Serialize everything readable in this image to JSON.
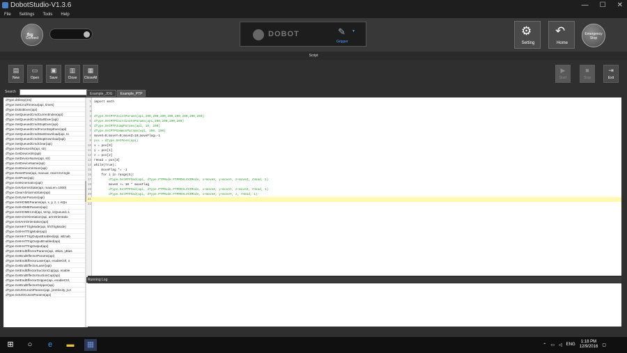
{
  "window": {
    "title": "DobotStudio-V1.3.6",
    "controls": [
      "—",
      "☐",
      "✕"
    ]
  },
  "menu": [
    "File",
    "Settings",
    "Tools",
    "Help"
  ],
  "topbar": {
    "connect_label": "Connect",
    "brand": "DOBOT",
    "end_tool": "Gripper",
    "setting_label": "Setting",
    "home_label": "Home",
    "estop_line1": "Emergency",
    "estop_line2": "Stop"
  },
  "section_title": "Script",
  "toolbar": {
    "new": "New",
    "open": "Open",
    "save": "Save",
    "close": "Close",
    "closeall": "CloseAll",
    "start": "Start",
    "stop": "Stop",
    "exit": "Exit"
  },
  "search": {
    "label": "Search",
    "value": ""
  },
  "api_list": [
    "dType.dSleep(ms)",
    "dType.SetCmdTimeout(api, times)",
    "dType.DobotExec(api)",
    "dType.SetQueuedCmdCurrentIndex(api)",
    "dType.SetQueuedCmdStartExec(api)",
    "dType.SetQueuedCmdStopExec(api)",
    "dType.SetQueuedCmdForceStopExec(api)",
    "dType.SetQueuedCmdStartDownload(api, to",
    "dType.SetQueuedCmdStopDownload(api)",
    "dType.SetQueuedCmdClear(api)",
    "dType.SetDeviceSN(api, str)",
    "dType.GetDeviceSN(api)",
    "dType.SetDeviceName(api, str)",
    "dType.GetDeviceName(api)",
    "dType.GetDeviceVersion(api)",
    "dType.ResetPose(api, manual, rearArmAngle",
    "dType.GetPose(api)",
    "dType.GetKinematics(api)",
    "dType.GetAlarmsState(api, maxLen=1000)",
    "dType.ClearAllAlarmsState(api)",
    "dType.GetUserParams(api)",
    "dType.SetHOMEParams(api, x, y, z, r, isQu",
    "dType.GetHOMEParams(api)",
    "dType.SetHOMECmd(api, temp, isQueued=1",
    "dType.SetArmOrientation(api, armOrientatio",
    "dType.GetArmOrientation(api)",
    "dType.SetHHTTrigMode(api, hhtTrigMode)",
    "dType.GetHHTTrigMode(api)",
    "dType.SetHHTTrigOutputEnabled(api, isEnab",
    "dType.GetHHTTrigOutputEnabled(api)",
    "dType.GetHHTTrigOutput(api)",
    "dType.SetEndEffectorParams(api, xBias, yBias",
    "dType.GetEndEffectorParams(api)",
    "dType.SetEndEffectorLaser(api, enableCtrl, o",
    "dType.GetEndEffectorLaser(api)",
    "dType.SetEndEffectorSuctionCup(api, enable",
    "dType.GetEndEffectorSuctionCup(api)",
    "dType.SetEndEffectorGripper(api, enableCtrl,",
    "dType.GetEndEffectorGripper(api)",
    "dType.SetJOGJointParams(api, j1Velocity, j1A",
    "dType.GetJOGJointParams(api)"
  ],
  "tabs": [
    "Example_JOG",
    "Example_PTP"
  ],
  "code": [
    "import math",
    "",
    "",
    "dType.SetPTPJointParams(api,200,200,200,200,200,200,200,200)",
    "dType.SetPTPCoordinateParams(api,200,200,200,200)",
    "dType.SetPTPJumpParams(api, 10, 200)",
    "dType.SetPTPCommonParams(api, 100, 100)",
    "moveX=0;moveY=0;moveZ=10;moveFlag=-1",
    "pos = dType.GetPose(api)",
    "x = pos[0]",
    "y = pos[1]",
    "z = pos[2]",
    "rHead = pos[3]",
    "while(True):",
    "    moveFlag *= -1",
    "    for i in range(5):",
    "        dType.SetPTPCmd(api, dType.PTPMode.PTPMOVLXYZMode, x+moveX, y+moveY, z+moveZ, rHead, 1)",
    "        moveX += 10 * moveFlag",
    "        dType.SetPTPCmd(api, dType.PTPMode.PTPMOVLXYZMode, x+moveX, y+moveY, z+moveZ, rHead, 1)",
    "        dType.SetPTPCmd(api, dType.PTPMode.PTPMOVLXYZMode, x+moveX, y+moveY, z, rHead, 1)",
    "",
    ""
  ],
  "log": {
    "title": "Running Log"
  },
  "taskbar": {
    "lang": "ENG",
    "time": "1:18 PM",
    "date": "12/9/2016"
  }
}
